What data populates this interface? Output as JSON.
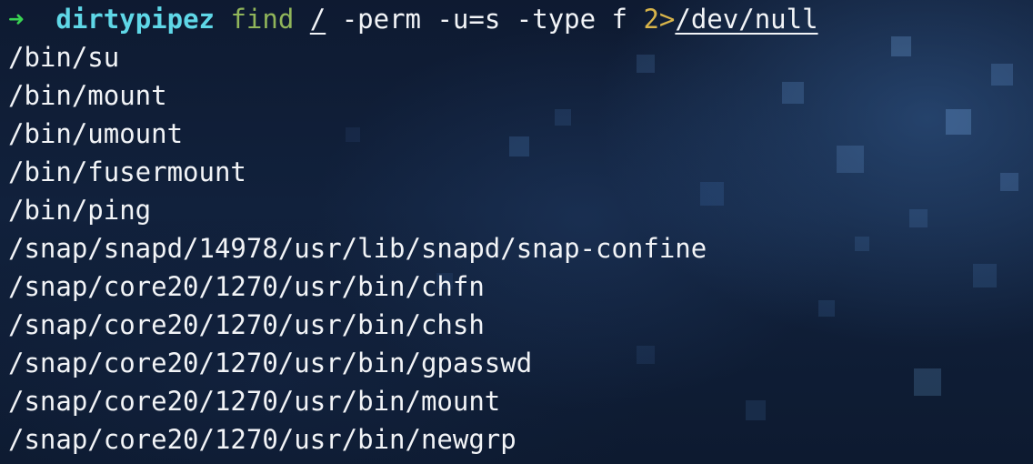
{
  "prompt": {
    "arrow": "➜",
    "directory": "dirtypipez"
  },
  "command": {
    "program": "find",
    "path": "/",
    "args": "-perm -u=s -type f",
    "redirect": "2>",
    "redirect_target": "/dev/null"
  },
  "output": [
    "/bin/su",
    "/bin/mount",
    "/bin/umount",
    "/bin/fusermount",
    "/bin/ping",
    "/snap/snapd/14978/usr/lib/snapd/snap-confine",
    "/snap/core20/1270/usr/bin/chfn",
    "/snap/core20/1270/usr/bin/chsh",
    "/snap/core20/1270/usr/bin/gpasswd",
    "/snap/core20/1270/usr/bin/mount",
    "/snap/core20/1270/usr/bin/newgrp"
  ],
  "colors": {
    "prompt_arrow": "#39d353",
    "prompt_directory": "#5fd7e7",
    "command": "#90b55a",
    "redirect": "#d8b44a",
    "text": "#f2f4f7",
    "background": "#0f1b32"
  }
}
